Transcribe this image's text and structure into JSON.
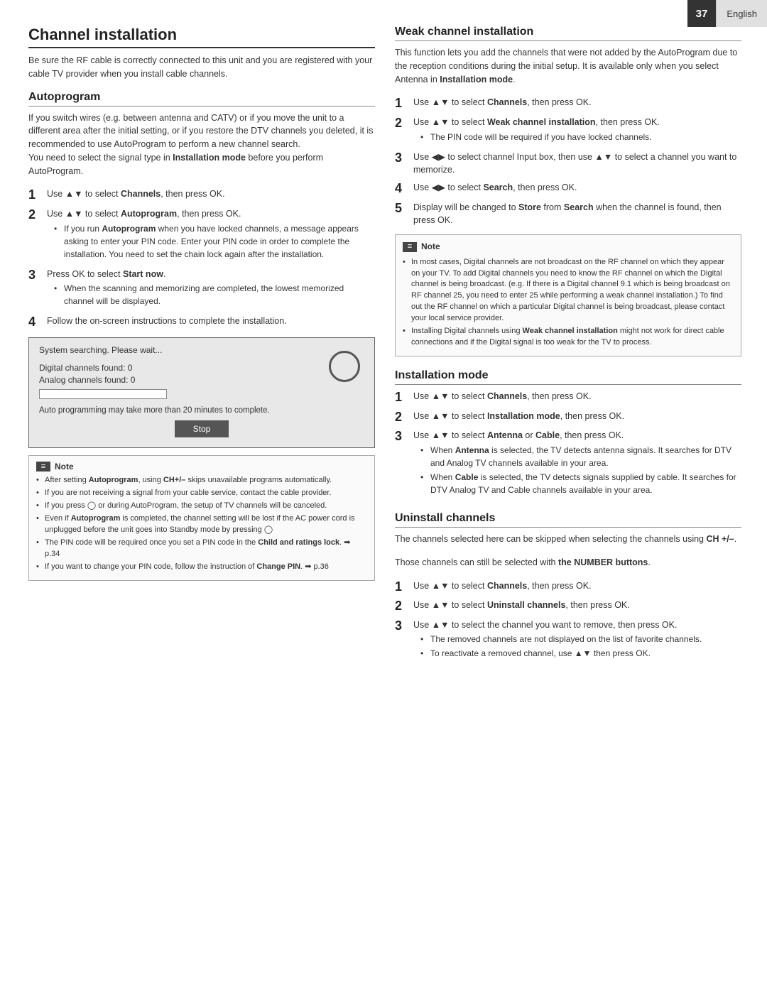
{
  "topbar": {
    "page_number": "37",
    "language": "English"
  },
  "left": {
    "main_title": "Channel installation",
    "intro": "Be sure the RF cable is correctly connected to this unit and you are registered with your cable TV provider when you install cable channels.",
    "autoprogram": {
      "title": "Autoprogram",
      "description": "If you switch wires (e.g. between antenna and CATV) or if you move the unit to a different area after the initial setting, or if you restore the DTV channels you deleted, it is recommended to use AutoProgram to perform a new channel search.\nYou need to select the signal type in Installation mode before you perform AutoProgram.",
      "bold_in_desc": "Installation mode",
      "steps": [
        {
          "num": "1",
          "text": "Use ▲▼ to select Channels, then press OK.",
          "bold": [
            "Channels"
          ]
        },
        {
          "num": "2",
          "text": "Use ▲▼ to select Autoprogram, then press OK.",
          "bold": [
            "Autoprogram"
          ],
          "bullets": [
            "If you run Autoprogram when you have locked channels, a message appears asking to enter your PIN code. Enter your PIN code in order to complete the installation. You need to set the chain lock again after the installation."
          ]
        },
        {
          "num": "3",
          "text": "Press OK to select Start now.",
          "bold": [
            "Start now"
          ],
          "bullets": [
            "When the scanning and memorizing are completed, the lowest memorized channel will be displayed."
          ]
        },
        {
          "num": "4",
          "text": "Follow the on-screen instructions to complete the installation."
        }
      ],
      "screen": {
        "line1": "System searching. Please wait...",
        "line2": "Digital channels found:  0",
        "line3": "Analog channels found:  0",
        "note_text": "Auto programming may take more than 20 minutes to complete.",
        "stop_button": "Stop"
      },
      "note": {
        "label": "Note",
        "bullets": [
          "After setting Autoprogram, using CH+/– skips unavailable programs automatically.",
          "If you are not receiving a signal from your cable service, contact the cable provider.",
          "If you press  or during AutoProgram, the setup of TV channels will be canceled.",
          "Even if Autoprogram is completed, the channel setting will be lost if the AC power cord is unplugged before the unit goes into Standby mode by pressing .",
          "The PIN code will be required once you set a PIN code in the Child and ratings lock.  ➡ p.34",
          "If you want to change your PIN code, follow the instruction of Change PIN. ➡ p.36"
        ]
      }
    }
  },
  "right": {
    "weak_channel": {
      "title": "Weak channel installation",
      "description": "This function lets you add the channels that were not added by the AutoProgram due to the reception conditions during the initial setup. It is available only when you select Antenna in Installation mode.",
      "bold_in_desc": "Installation mode",
      "steps": [
        {
          "num": "1",
          "text": "Use ▲▼ to select Channels, then press OK.",
          "bold": [
            "Channels"
          ]
        },
        {
          "num": "2",
          "text": "Use ▲▼ to select Weak channel installation, then press OK.",
          "bold": [
            "Weak channel installation"
          ],
          "bullets": [
            "The PIN code will be required if you have locked channels."
          ]
        },
        {
          "num": "3",
          "text": "Use ◀▶ to select channel Input box, then use ▲▼ to select a channel you want to memorize."
        },
        {
          "num": "4",
          "text": "Use ◀▶ to select Search, then press OK.",
          "bold": [
            "Search"
          ]
        },
        {
          "num": "5",
          "text": "Display will be changed to Store from Search when the channel is found, then press OK.",
          "bold": [
            "Store",
            "Search"
          ]
        }
      ],
      "note": {
        "label": "Note",
        "bullets": [
          "In most cases, Digital channels are not broadcast on the RF channel on which they appear on your TV. To add Digital channels you need to know the RF channel on which the Digital channel is being broadcast. (e.g. If there is a Digital channel 9.1 which is being broadcast on RF channel 25, you need to enter 25 while performing a weak channel installation.) To find out the RF channel on which a particular Digital channel is being broadcast, please contact your local service provider.",
          "Installing Digital channels using Weak channel installation might not work for direct cable connections and if the Digital signal is too weak for the TV to process."
        ]
      }
    },
    "installation_mode": {
      "title": "Installation mode",
      "steps": [
        {
          "num": "1",
          "text": "Use ▲▼ to select Channels, then press OK.",
          "bold": [
            "Channels"
          ]
        },
        {
          "num": "2",
          "text": "Use ▲▼ to select Installation mode, then press OK.",
          "bold": [
            "Installation mode"
          ]
        },
        {
          "num": "3",
          "text": "Use ▲▼ to select Antenna or Cable, then press OK.",
          "bold": [
            "Antenna",
            "Cable"
          ],
          "bullets": [
            "When Antenna is selected, the TV detects antenna signals. It searches for DTV and Analog TV channels available in your area.",
            "When Cable is selected, the TV detects signals supplied by cable. It searches for DTV Analog TV and Cable channels available in your area."
          ]
        }
      ]
    },
    "uninstall_channels": {
      "title": "Uninstall channels",
      "description": "The channels selected here can be skipped when selecting the channels using CH +/–.",
      "description2": "Those channels can still be selected with the NUMBER buttons.",
      "bold_in_desc2": "the NUMBER buttons",
      "steps": [
        {
          "num": "1",
          "text": "Use ▲▼ to select Channels, then press OK.",
          "bold": [
            "Channels"
          ]
        },
        {
          "num": "2",
          "text": "Use ▲▼ to select Uninstall channels, then press OK.",
          "bold": [
            "Uninstall channels"
          ]
        },
        {
          "num": "3",
          "text": "Use ▲▼ to select the channel you want to remove, then press OK.",
          "bullets": [
            "The removed channels are not displayed on the list of favorite channels.",
            "To reactivate a removed channel, use ▲▼ then press OK."
          ]
        }
      ]
    }
  }
}
